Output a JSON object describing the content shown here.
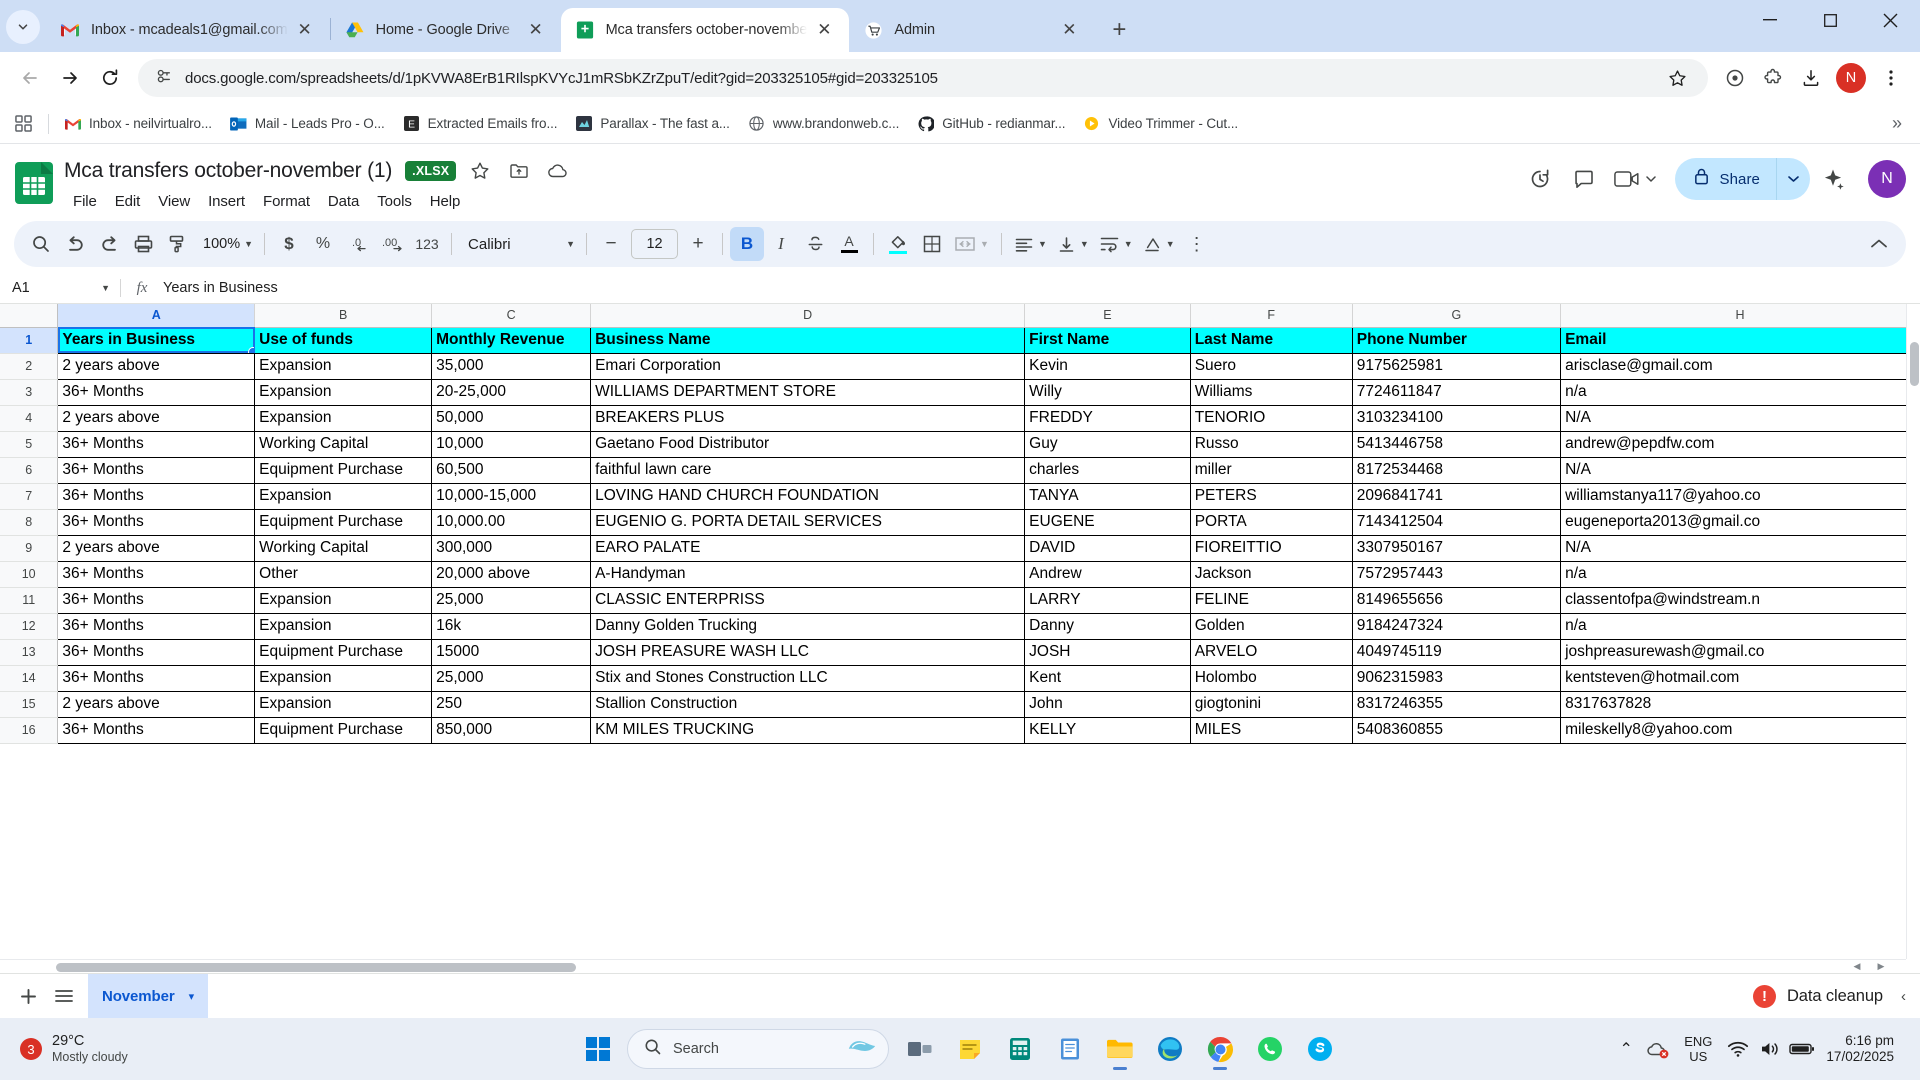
{
  "browser": {
    "tabs": [
      {
        "title": "Inbox - mcadeals1@gmail.com",
        "icon": "gmail-icon",
        "active": false
      },
      {
        "title": "Home - Google Drive",
        "icon": "google-drive-icon",
        "active": false
      },
      {
        "title": "Mca transfers october-novembe",
        "icon": "google-sheets-icon",
        "active": true
      },
      {
        "title": "Admin",
        "icon": "shopping-cart-icon",
        "active": false
      }
    ],
    "url": "docs.google.com/spreadsheets/d/1pKVWA8ErB1RIlspKVYcJ1mRSbKZrZpuT/edit?gid=203325105#gid=203325105",
    "profile_initial": "N",
    "window_controls": {
      "minimize": "—",
      "maximize": "☐",
      "close": "✕"
    },
    "new_tab_label": "+",
    "bookmarks": [
      {
        "label": "Inbox - neilvirtualro...",
        "icon": "gmail-icon"
      },
      {
        "label": "Mail - Leads Pro - O...",
        "icon": "outlook-icon"
      },
      {
        "label": "Extracted Emails fro...",
        "icon": "evernote-icon"
      },
      {
        "label": "Parallax - The fast a...",
        "icon": "parallax-icon"
      },
      {
        "label": "www.brandonweb.c...",
        "icon": "globe-icon"
      },
      {
        "label": "GitHub - redianmar...",
        "icon": "github-icon"
      },
      {
        "label": "Video Trimmer - Cut...",
        "icon": "video-icon"
      }
    ],
    "bookmarks_overflow": "»"
  },
  "sheets": {
    "doc_title": "Mca transfers october-november (1)",
    "format_badge": ".XLSX",
    "menus": [
      "File",
      "Edit",
      "View",
      "Insert",
      "Format",
      "Data",
      "Tools",
      "Help"
    ],
    "share_label": "Share",
    "account_initial": "N",
    "toolbar": {
      "zoom": "100%",
      "font": "Calibri",
      "font_size": "12",
      "currency": "$",
      "percent": "%",
      "decimal_decrease": ".0",
      "decimal_increase": ".00",
      "number_format": "123",
      "bold": "B",
      "italic": "I",
      "strikethrough": "S",
      "text_color": "A",
      "minus": "−",
      "plus": "+",
      "more": "⋮"
    },
    "formula_bar": {
      "name_box": "A1",
      "fx_label": "fx",
      "formula": "Years in Business"
    },
    "grid": {
      "columns": [
        "A",
        "B",
        "C",
        "D",
        "E",
        "F",
        "G",
        "H"
      ],
      "selected_column": "A",
      "selected_row": "1",
      "selected_cell": "A1",
      "header_row": [
        "Years in Business",
        "Use of funds",
        "Monthly Revenue",
        "Business Name",
        "First Name",
        "Last Name",
        "Phone Number",
        "Email"
      ],
      "header_bg": "#00ffff",
      "rows": [
        {
          "n": "2",
          "cells": [
            "2 years above",
            "Expansion",
            "35,000",
            "Emari Corporation",
            "Kevin",
            "Suero",
            "9175625981",
            "arisclase@gmail.com"
          ]
        },
        {
          "n": "3",
          "cells": [
            "36+ Months",
            "Expansion",
            "20-25,000",
            "WILLIAMS DEPARTMENT STORE",
            "Willy",
            "Williams",
            "7724611847",
            "n/a"
          ]
        },
        {
          "n": "4",
          "cells": [
            "2 years above",
            "Expansion",
            "50,000",
            "BREAKERS PLUS",
            "FREDDY",
            "TENORIO",
            "3103234100",
            "N/A"
          ]
        },
        {
          "n": "5",
          "cells": [
            "36+ Months",
            "Working Capital",
            "10,000",
            "Gaetano Food Distributor",
            "Guy",
            "Russo",
            "5413446758",
            "andrew@pepdfw.com"
          ]
        },
        {
          "n": "6",
          "cells": [
            "36+ Months",
            "Equipment Purchase",
            "60,500",
            "faithful lawn care",
            "charles",
            "miller",
            "8172534468",
            "N/A"
          ]
        },
        {
          "n": "7",
          "cells": [
            "36+ Months",
            "Expansion",
            "10,000-15,000",
            "LOVING HAND CHURCH FOUNDATION",
            "TANYA",
            "PETERS",
            "2096841741",
            "williamstanya117@yahoo.co"
          ]
        },
        {
          "n": "8",
          "cells": [
            "36+ Months",
            "Equipment Purchase",
            "10,000.00",
            "EUGENIO G. PORTA DETAIL SERVICES",
            "EUGENE",
            "PORTA",
            "7143412504",
            "eugeneporta2013@gmail.co"
          ]
        },
        {
          "n": "9",
          "cells": [
            "2 years above",
            "Working Capital",
            "300,000",
            "EARO PALATE",
            "DAVID",
            "FIOREITTIO",
            "3307950167",
            "N/A"
          ]
        },
        {
          "n": "10",
          "cells": [
            "36+ Months",
            "Other",
            "20,000 above",
            "A-Handyman",
            "Andrew",
            "Jackson",
            "7572957443",
            "n/a"
          ]
        },
        {
          "n": "11",
          "cells": [
            "36+ Months",
            "Expansion",
            "25,000",
            "CLASSIC ENTERPRISS",
            "LARRY",
            "FELINE",
            "8149655656",
            "classentofpa@windstream.n"
          ]
        },
        {
          "n": "12",
          "cells": [
            "36+ Months",
            "Expansion",
            "16k",
            "Danny Golden Trucking",
            "Danny",
            "Golden",
            "9184247324",
            "n/a"
          ]
        },
        {
          "n": "13",
          "cells": [
            "36+ Months",
            "Equipment Purchase",
            "15000",
            "JOSH PREASURE WASH LLC",
            "JOSH",
            "ARVELO",
            "4049745119",
            "joshpreasurewash@gmail.co"
          ]
        },
        {
          "n": "14",
          "cells": [
            "36+ Months",
            "Expansion",
            "25,000",
            "Stix and Stones  Construction LLC",
            "Kent",
            "Holombo",
            "9062315983",
            "kentsteven@hotmail.com"
          ]
        },
        {
          "n": "15",
          "cells": [
            "2 years above",
            "Expansion",
            "250",
            "Stallion Construction",
            "John",
            "giogtonini",
            "8317246355",
            "8317637828"
          ]
        },
        {
          "n": "16",
          "cells": [
            "36+ Months",
            "Equipment Purchase",
            "850,000",
            "KM MILES TRUCKING",
            "KELLY",
            "MILES",
            "5408360855",
            "mileskelly8@yahoo.com"
          ]
        }
      ]
    },
    "sheet_tabs": {
      "add_label": "+",
      "all_sheets_label": "☰",
      "active_sheet": "November",
      "caret": "▾"
    },
    "status": {
      "cleanup_label": "Data cleanup",
      "cleanup_badge": "!",
      "collapse": "‹"
    }
  },
  "taskbar": {
    "weather": {
      "badge": "3",
      "temp": "29°C",
      "desc": "Mostly cloudy"
    },
    "search_placeholder": "Search",
    "apps": [
      {
        "name": "task-view-icon",
        "running": false
      },
      {
        "name": "sticky-notes-icon",
        "running": false
      },
      {
        "name": "calculator-icon",
        "running": false
      },
      {
        "name": "notepad-icon",
        "running": false
      },
      {
        "name": "file-explorer-icon",
        "running": true
      },
      {
        "name": "microsoft-edge-icon",
        "running": false
      },
      {
        "name": "google-chrome-icon",
        "running": true
      },
      {
        "name": "whatsapp-icon",
        "running": false
      },
      {
        "name": "skype-icon",
        "running": false
      }
    ],
    "language": {
      "line1": "ENG",
      "line2": "US"
    },
    "clock": {
      "time": "6:16 pm",
      "date": "17/02/2025"
    },
    "tray_expand": "⌃"
  }
}
